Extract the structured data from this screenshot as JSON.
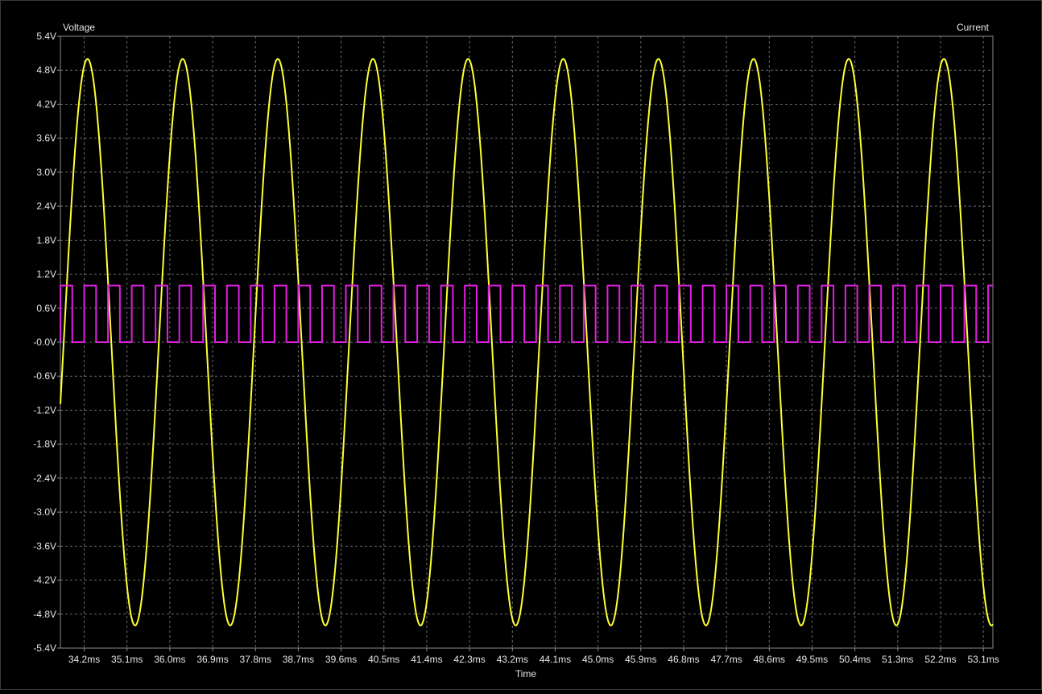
{
  "chart_data": {
    "type": "line",
    "left_axis_label": "Voltage",
    "right_axis_label": "Current",
    "xlabel": "Time",
    "xlim": [
      33.7,
      53.3
    ],
    "ylim": [
      -5.4,
      5.4
    ],
    "grid": true,
    "x_ticks": [
      34.2,
      35.1,
      36.0,
      36.9,
      37.8,
      38.7,
      39.6,
      40.5,
      41.4,
      42.3,
      43.2,
      44.1,
      45.0,
      45.9,
      46.8,
      47.7,
      48.6,
      49.5,
      50.4,
      51.3,
      52.2,
      53.1
    ],
    "x_tick_labels": [
      "34.2ms",
      "35.1ms",
      "36.0ms",
      "36.9ms",
      "37.8ms",
      "38.7ms",
      "39.6ms",
      "40.5ms",
      "41.4ms",
      "42.3ms",
      "43.2ms",
      "44.1ms",
      "45.0ms",
      "45.9ms",
      "46.8ms",
      "47.7ms",
      "48.6ms",
      "49.5ms",
      "50.4ms",
      "51.3ms",
      "52.2ms",
      "53.1ms"
    ],
    "y_ticks": [
      5.4,
      4.8,
      4.2,
      3.6,
      3.0,
      2.4,
      1.8,
      1.2,
      0.6,
      0.0,
      -0.6,
      -1.2,
      -1.8,
      -2.4,
      -3.0,
      -3.6,
      -4.2,
      -4.8,
      -5.4
    ],
    "y_tick_labels": [
      "5.4V",
      "4.8V",
      "4.2V",
      "3.6V",
      "3.0V",
      "2.4V",
      "1.8V",
      "1.2V",
      "0.6V",
      "-0.0V",
      "-0.6V",
      "-1.2V",
      "-1.8V",
      "-2.4V",
      "-3.0V",
      "-3.6V",
      "-4.2V",
      "-4.8V",
      "-5.4V"
    ],
    "series": [
      {
        "kind": "sine",
        "color": "#ffff33",
        "amplitude": 5.0,
        "offset": 0.0,
        "period_ms": 2.0,
        "peak_at_ms": 34.27
      },
      {
        "kind": "square",
        "color": "#e020e0",
        "high": 1.0,
        "low": 0.0,
        "period_ms": 0.5,
        "first_rise_ms": 33.7,
        "duty": 0.5
      }
    ]
  }
}
